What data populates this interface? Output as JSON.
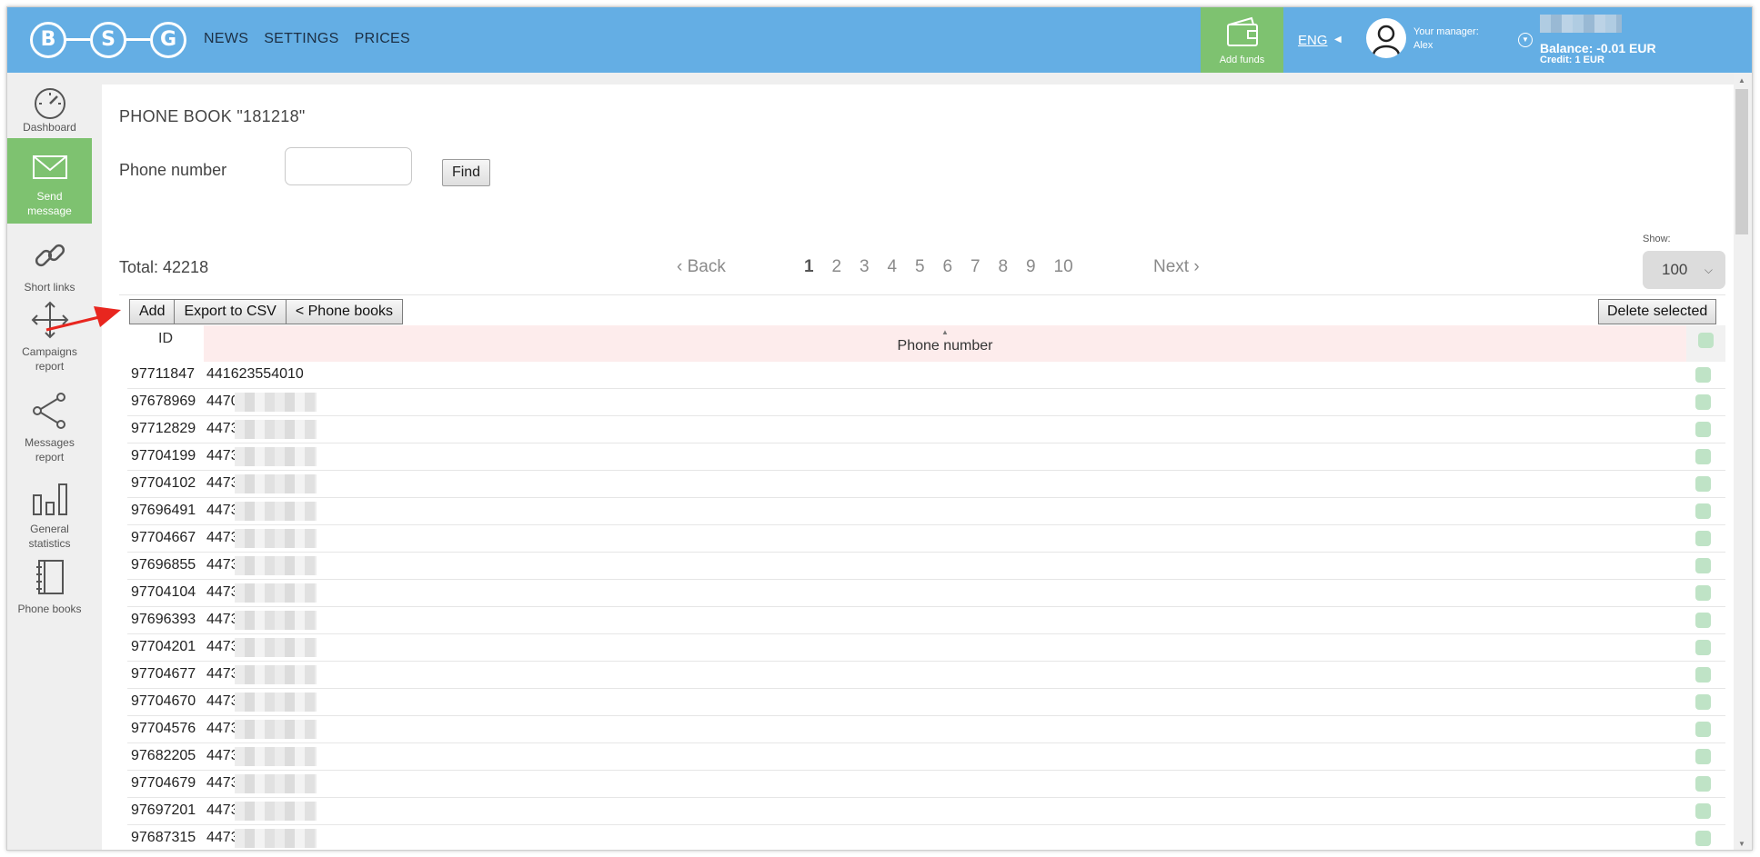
{
  "logo": {
    "letters": [
      "B",
      "S",
      "G"
    ]
  },
  "nav": {
    "items": [
      "NEWS",
      "SETTINGS",
      "PRICES"
    ]
  },
  "header": {
    "add_funds": "Add funds",
    "lang": "ENG",
    "manager_label": "Your manager:",
    "manager_name": "Alex",
    "balance": "Balance: -0.01 EUR",
    "credit": "Credit: 1 EUR"
  },
  "sidebar": {
    "items": [
      {
        "label": "Dashboard",
        "icon": "speedometer-icon"
      },
      {
        "label": "Send message",
        "icon": "envelope-icon",
        "active": true
      },
      {
        "label": "Short links",
        "icon": "link-icon"
      },
      {
        "label": "Campaigns report",
        "icon": "move-arrows-icon"
      },
      {
        "label": "Messages report",
        "icon": "share-icon"
      },
      {
        "label": "General statistics",
        "icon": "bar-chart-icon"
      },
      {
        "label": "Phone books",
        "icon": "notebook-icon"
      }
    ]
  },
  "page": {
    "title": "PHONE BOOK \"181218\"",
    "search_label": "Phone number",
    "find_label": "Find",
    "total": "Total: 42218"
  },
  "pager": {
    "back": "‹ Back",
    "pages": [
      "1",
      "2",
      "3",
      "4",
      "5",
      "6",
      "7",
      "8",
      "9",
      "10"
    ],
    "current": "1",
    "next": "Next ›"
  },
  "show": {
    "label": "Show:",
    "value": "100"
  },
  "toolbar": {
    "add": "Add",
    "export": "Export to CSV",
    "phone_books": "< Phone books",
    "delete_selected": "Delete selected"
  },
  "table": {
    "headers": {
      "id": "ID",
      "phone": "Phone number"
    },
    "rows": [
      {
        "id": "97711847",
        "phone": "441623554010"
      },
      {
        "id": "97678969",
        "phone": "4470"
      },
      {
        "id": "97712829",
        "phone": "4473"
      },
      {
        "id": "97704199",
        "phone": "4473"
      },
      {
        "id": "97704102",
        "phone": "4473"
      },
      {
        "id": "97696491",
        "phone": "4473"
      },
      {
        "id": "97704667",
        "phone": "4473"
      },
      {
        "id": "97696855",
        "phone": "4473"
      },
      {
        "id": "97704104",
        "phone": "4473"
      },
      {
        "id": "97696393",
        "phone": "4473"
      },
      {
        "id": "97704201",
        "phone": "4473"
      },
      {
        "id": "97704677",
        "phone": "4473"
      },
      {
        "id": "97704670",
        "phone": "4473"
      },
      {
        "id": "97704576",
        "phone": "4473"
      },
      {
        "id": "97682205",
        "phone": "4473"
      },
      {
        "id": "97704679",
        "phone": "4473"
      },
      {
        "id": "97697201",
        "phone": "4473"
      },
      {
        "id": "97687315",
        "phone": "4473"
      }
    ]
  },
  "colors": {
    "topbar": "#64aee4",
    "accent_green": "#7ec270",
    "header_pink": "#fdecec",
    "annotation_arrow": "#e8261f"
  }
}
